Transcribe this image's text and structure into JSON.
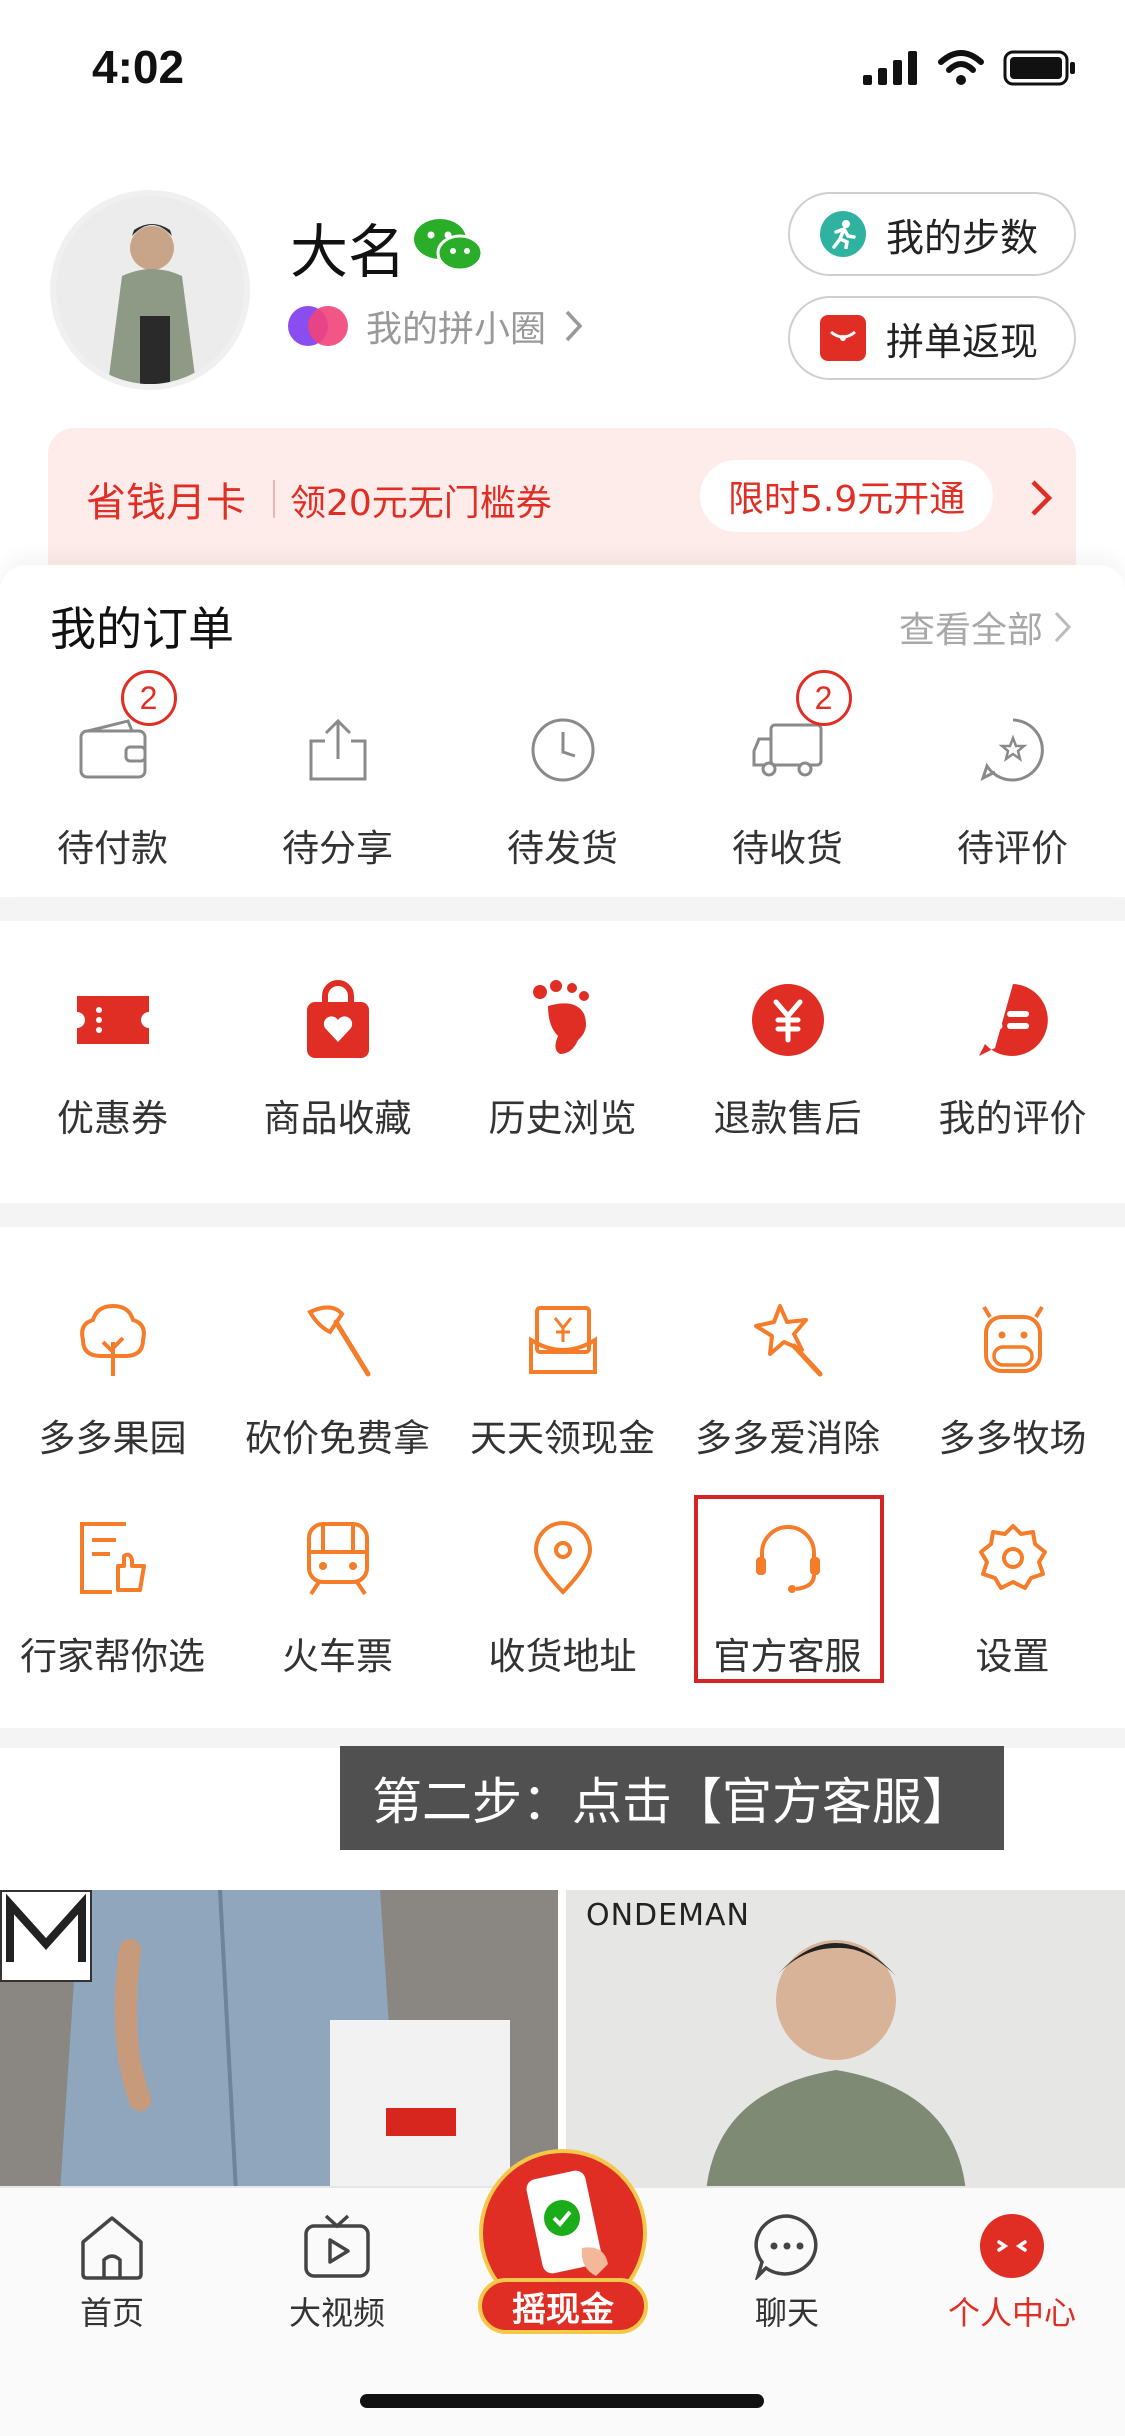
{
  "status_bar": {
    "time": "4:02"
  },
  "profile": {
    "name": "大名",
    "circle_link": "我的拼小圈",
    "steps_button": "我的步数",
    "rebate_button": "拼单返现"
  },
  "savings_card": {
    "title": "省钱月卡",
    "desc": "领20元无门槛券",
    "cta": "限时5.9元开通"
  },
  "orders": {
    "title": "我的订单",
    "view_all": "查看全部",
    "items": [
      {
        "label": "待付款",
        "icon": "wallet-icon",
        "badge": "2"
      },
      {
        "label": "待分享",
        "icon": "share-icon"
      },
      {
        "label": "待发货",
        "icon": "clock-icon"
      },
      {
        "label": "待收货",
        "icon": "truck-icon",
        "badge": "2"
      },
      {
        "label": "待评价",
        "icon": "review-icon"
      }
    ]
  },
  "shortcuts": [
    {
      "label": "优惠券",
      "icon": "coupon-icon"
    },
    {
      "label": "商品收藏",
      "icon": "favorite-bag-icon"
    },
    {
      "label": "历史浏览",
      "icon": "footprint-icon"
    },
    {
      "label": "退款售后",
      "icon": "refund-icon"
    },
    {
      "label": "我的评价",
      "icon": "comment-icon"
    }
  ],
  "services_row1": [
    {
      "label": "多多果园",
      "icon": "tree-icon"
    },
    {
      "label": "砍价免费拿",
      "icon": "axe-icon"
    },
    {
      "label": "天天领现金",
      "icon": "cash-icon"
    },
    {
      "label": "多多爱消除",
      "icon": "star-wand-icon"
    },
    {
      "label": "多多牧场",
      "icon": "cow-icon"
    }
  ],
  "services_row2": [
    {
      "label": "行家帮你选",
      "icon": "expert-icon"
    },
    {
      "label": "火车票",
      "icon": "train-icon"
    },
    {
      "label": "收货地址",
      "icon": "location-icon"
    },
    {
      "label": "官方客服",
      "icon": "headset-icon"
    },
    {
      "label": "设置",
      "icon": "gear-icon"
    }
  ],
  "caption": "第二步：点击【官方客服】",
  "products": {
    "right_brand": "ONDEMAN"
  },
  "tabbar": {
    "home": "首页",
    "video": "大视频",
    "center": "摇现金",
    "chat": "聊天",
    "me": "个人中心"
  },
  "colors": {
    "accent": "#e02e24",
    "service_orange": "#f57c29"
  }
}
